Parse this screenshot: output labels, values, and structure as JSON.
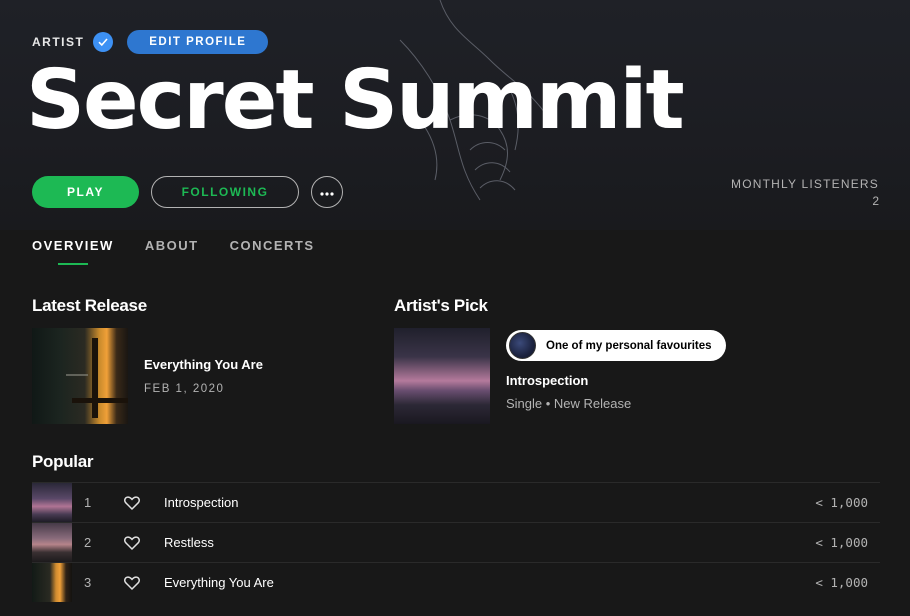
{
  "header": {
    "artist_label": "ARTIST",
    "edit_profile_label": "EDIT PROFILE",
    "artist_name": "Secret Summit",
    "play_label": "PLAY",
    "following_label": "FOLLOWING",
    "more_label": "•••",
    "monthly_listeners_label": "MONTHLY LISTENERS",
    "monthly_listeners_value": "2"
  },
  "tabs": [
    {
      "label": "OVERVIEW",
      "active": true
    },
    {
      "label": "ABOUT",
      "active": false
    },
    {
      "label": "CONCERTS",
      "active": false
    }
  ],
  "latest_release": {
    "section_title": "Latest Release",
    "name": "Everything You Are",
    "date": "FEB 1, 2020"
  },
  "artists_pick": {
    "section_title": "Artist's Pick",
    "quote": "One of my personal favourites",
    "title": "Introspection",
    "subtitle": "Single • New Release"
  },
  "popular": {
    "section_title": "Popular",
    "tracks": [
      {
        "num": "1",
        "name": "Introspection",
        "plays": "< 1,000"
      },
      {
        "num": "2",
        "name": "Restless",
        "plays": "< 1,000"
      },
      {
        "num": "3",
        "name": "Everything You Are",
        "plays": "< 1,000"
      }
    ]
  },
  "colors": {
    "accent_green": "#1db954",
    "verified_blue": "#3d91f4",
    "edit_button_blue": "#2e77d0",
    "background": "#181818"
  },
  "icons": {
    "verified": "verified-check-icon",
    "heart": "heart-outline-icon",
    "more": "more-dots-icon"
  }
}
